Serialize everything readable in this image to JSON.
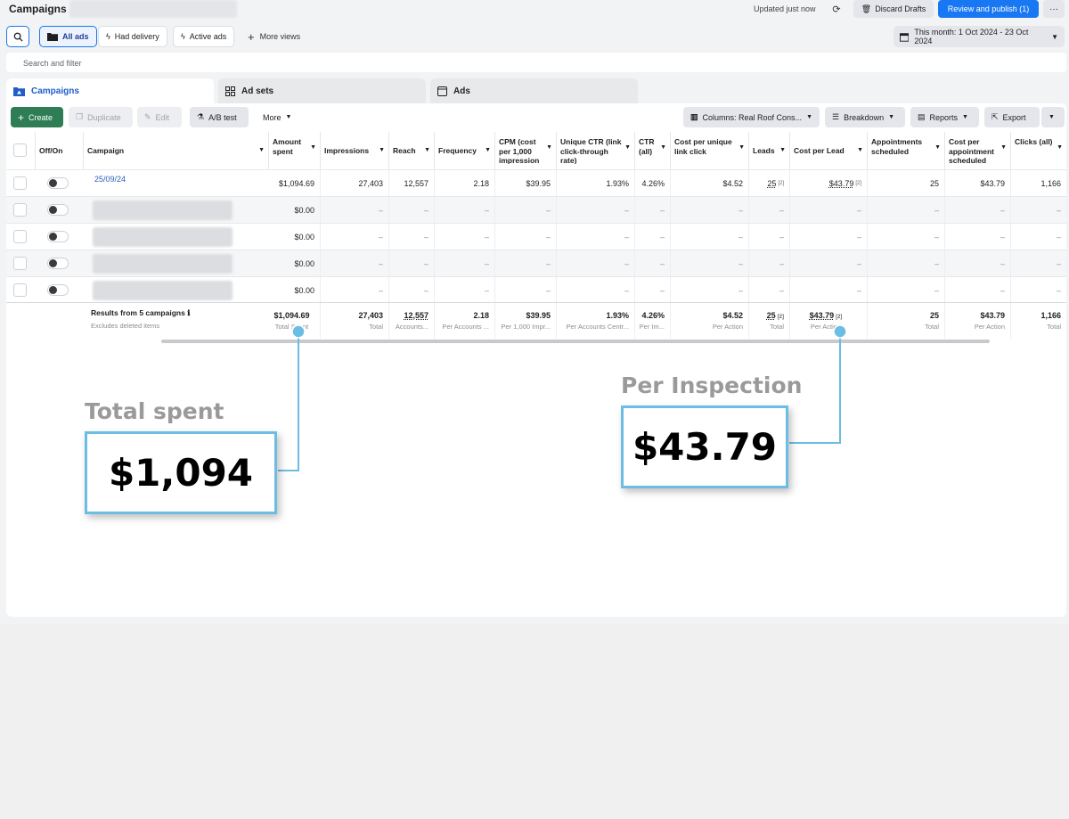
{
  "header": {
    "title": "Campaigns",
    "updated": "Updated just now",
    "discard_label": "Discard Drafts",
    "review_label": "Review and publish (1)",
    "more_label": "···"
  },
  "views": {
    "all_ads": "All ads",
    "had_delivery": "Had delivery",
    "active_ads": "Active ads",
    "more_views": "More views",
    "date_range": "This month: 1 Oct 2024 - 23 Oct 2024"
  },
  "filter": {
    "placeholder": "Search and filter"
  },
  "tabs": {
    "campaigns": "Campaigns",
    "ad_sets": "Ad sets",
    "ads": "Ads"
  },
  "toolbar": {
    "create": "Create",
    "duplicate": "Duplicate",
    "edit": "Edit",
    "ab_test": "A/B test",
    "more": "More",
    "columns": "Columns: Real Roof Cons...",
    "breakdown": "Breakdown",
    "reports": "Reports",
    "export": "Export"
  },
  "table": {
    "headers": {
      "offon": "Off/On",
      "campaign": "Campaign",
      "amount_spent": "Amount spent",
      "impressions": "Impressions",
      "reach": "Reach",
      "frequency": "Frequency",
      "cpm": "CPM (cost per 1,000 impression",
      "unique_ctr": "Unique CTR (link click-through rate)",
      "ctr": "CTR (all)",
      "cost_unique_link": "Cost per unique link click",
      "leads": "Leads",
      "cost_per_lead": "Cost per Lead",
      "appointments": "Appointments scheduled",
      "cost_appointment": "Cost per appointment scheduled",
      "clicks": "Clicks (all)"
    },
    "row1": {
      "campaign": "25/09/24",
      "amount_spent": "$1,094.69",
      "impressions": "27,403",
      "reach": "12,557",
      "frequency": "2.18",
      "cpm": "$39.95",
      "unique_ctr": "1.93%",
      "ctr": "4.26%",
      "cost_unique_link": "$4.52",
      "leads": "25",
      "cost_per_lead": "$43.79",
      "appointments": "25",
      "cost_appointment": "$43.79",
      "clicks": "1,166",
      "mark": "[2]"
    },
    "zero_spent": "$0.00",
    "dash": "–",
    "totals": {
      "label": "Results from 5 campaigns",
      "info_icon": "ℹ",
      "sub": "Excludes deleted items",
      "amount_spent": "$1,094.69",
      "amount_spent_sub": "Total Spent",
      "impressions": "27,403",
      "impressions_sub": "Total",
      "reach": "12,557",
      "reach_sub": "Accounts...",
      "frequency": "2.18",
      "frequency_sub": "Per Accounts ...",
      "cpm": "$39.95",
      "cpm_sub": "Per 1,000 Impr...",
      "unique_ctr": "1.93%",
      "unique_ctr_sub": "Per Accounts Centr...",
      "ctr": "4.26%",
      "ctr_sub": "Per Im...",
      "cost_unique_link": "$4.52",
      "cost_unique_link_sub": "Per Action",
      "leads": "25",
      "leads_sub": "Total",
      "cost_per_lead": "$43.79",
      "cost_per_lead_sub": "Per Action",
      "appointments": "25",
      "appointments_sub": "Total",
      "cost_appointment": "$43.79",
      "cost_appointment_sub": "Per Action",
      "clicks": "1,166",
      "clicks_sub": "Total"
    }
  },
  "callouts": {
    "left_label": "Total spent",
    "left_value": "$1,094",
    "right_label": "Per Inspection",
    "right_value": "$43.79",
    "line_color": "#6cbde3"
  },
  "colors": {
    "primary_blue": "#1877f2",
    "create_green": "#2e7d55",
    "link_blue": "#2b5fbf"
  }
}
